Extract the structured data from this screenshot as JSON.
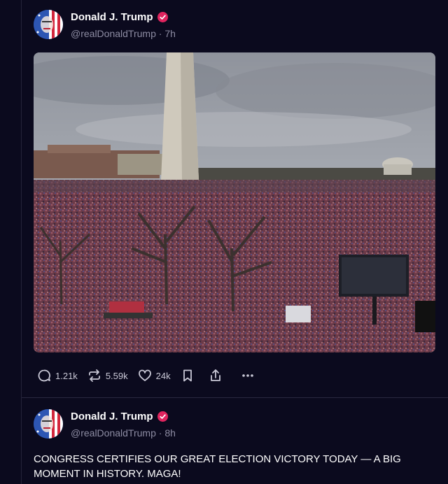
{
  "post1": {
    "author": "Donald J. Trump",
    "handle": "@realDonaldTrump",
    "separator": "·",
    "time": "7h",
    "actions": {
      "replies": "1.21k",
      "reposts": "5.59k",
      "likes": "24k"
    }
  },
  "post2": {
    "author": "Donald J. Trump",
    "handle": "@realDonaldTrump",
    "separator": "·",
    "time": "8h",
    "text": "CONGRESS CERTIFIES OUR GREAT ELECTION VICTORY TODAY — A BIG MOMENT IN HISTORY. MAGA!"
  },
  "colors": {
    "background": "#0b0a1e",
    "verified": "#e0245e",
    "muted_text": "#8d8ca3"
  },
  "icons": [
    "reply-icon",
    "repost-icon",
    "like-icon",
    "bookmark-icon",
    "share-icon",
    "more-icon",
    "verified-badge-icon"
  ]
}
